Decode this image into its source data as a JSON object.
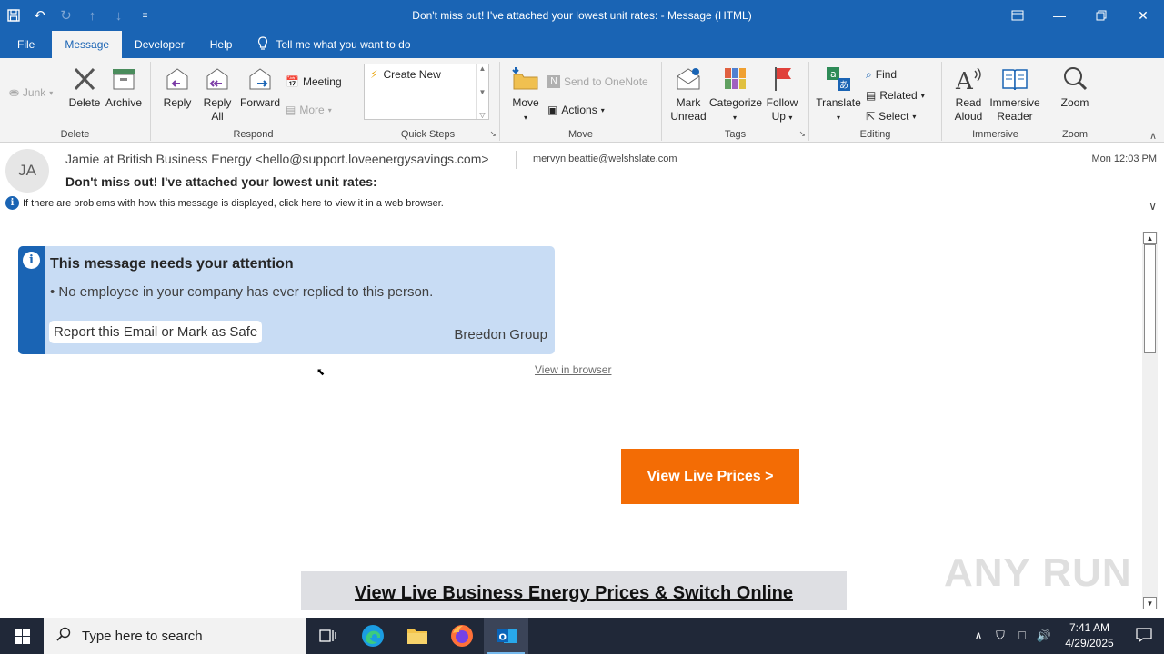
{
  "window": {
    "title": "Don't miss out! I've attached your lowest unit rates:  -  Message (HTML)"
  },
  "tabs": [
    "File",
    "Message",
    "Developer",
    "Help"
  ],
  "tell_me": "Tell me what you want to do",
  "ribbon": {
    "delete_group": {
      "label": "Delete",
      "junk": "Junk",
      "delete": "Delete",
      "archive": "Archive"
    },
    "respond_group": {
      "label": "Respond",
      "reply": "Reply",
      "reply_all_1": "Reply",
      "reply_all_2": "All",
      "forward": "Forward",
      "meeting": "Meeting",
      "more": "More"
    },
    "quick_steps": {
      "label": "Quick Steps",
      "create_new": "Create New"
    },
    "move_group": {
      "label": "Move",
      "move": "Move",
      "onenote": "Send to OneNote",
      "actions": "Actions"
    },
    "tags_group": {
      "label": "Tags",
      "mark_1": "Mark",
      "mark_2": "Unread",
      "categorize": "Categorize",
      "follow_1": "Follow",
      "follow_2": "Up"
    },
    "editing_group": {
      "label": "Editing",
      "translate": "Translate",
      "find": "Find",
      "related": "Related",
      "select": "Select"
    },
    "immersive_group": {
      "label": "Immersive",
      "read_1": "Read",
      "read_2": "Aloud",
      "immersive_1": "Immersive",
      "immersive_2": "Reader"
    },
    "zoom_group": {
      "label": "Zoom",
      "zoom": "Zoom"
    }
  },
  "message": {
    "avatar_initials": "JA",
    "from": "Jamie at British Business Energy <hello@support.loveenergysavings.com>",
    "to": "mervyn.beattie@welshslate.com",
    "datetime": "Mon 12:03 PM",
    "subject": "Don't miss out! I've attached your lowest unit rates:",
    "info_bar": "If there are problems with how this message is displayed, click here to view it in a web browser."
  },
  "alert": {
    "title": "This message needs your attention",
    "line": "• No employee in your company has ever replied to this person.",
    "button": "Report this Email or Mark as Safe",
    "org": "Breedon Group"
  },
  "email_body": {
    "view_in_browser": "View in browser",
    "cta_button": "View Live Prices >",
    "banner": "View Live Business Energy Prices & Switch Online"
  },
  "watermark": "ANY RUN",
  "taskbar": {
    "search_placeholder": "Type here to search",
    "time": "7:41 AM",
    "date": "4/29/2025"
  }
}
